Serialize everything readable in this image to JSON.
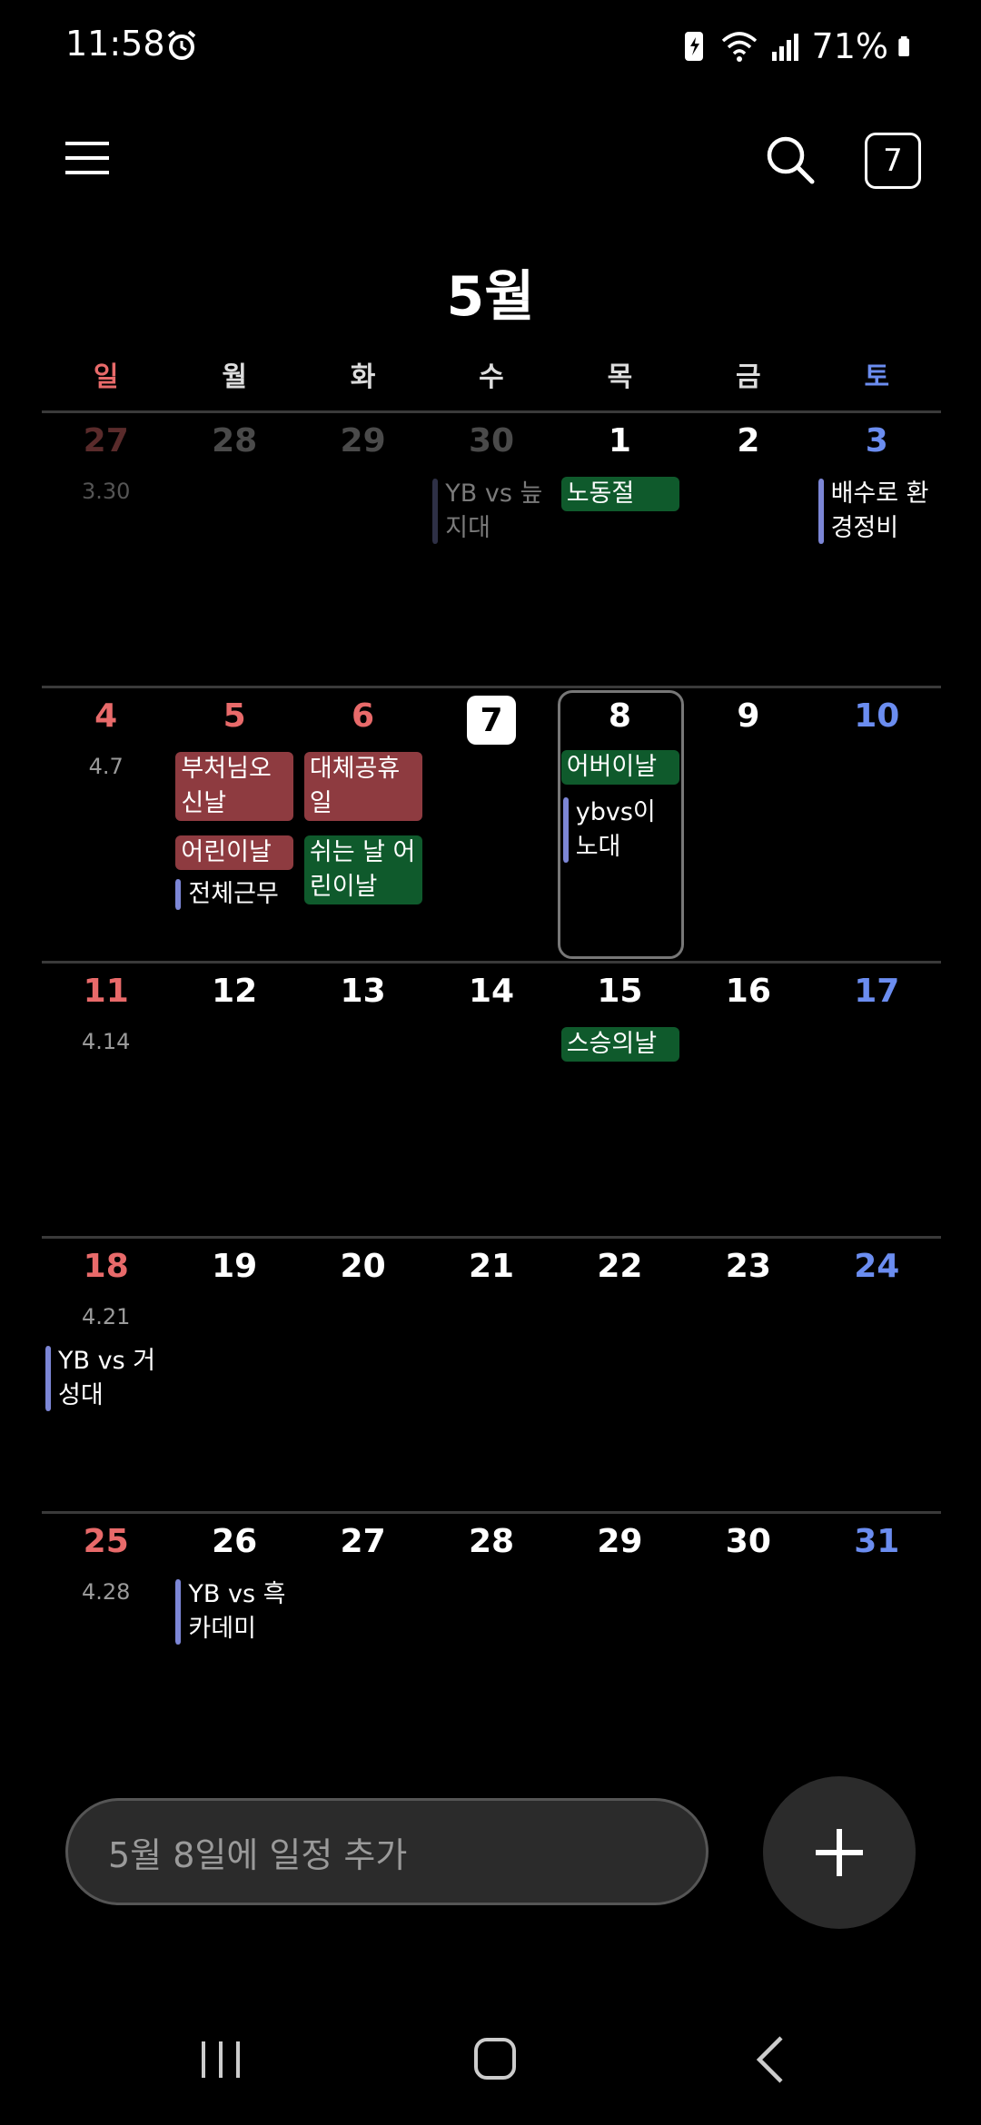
{
  "status": {
    "time": "11:58",
    "battery": "71%"
  },
  "header": {
    "today_button": "7",
    "month_title": "5월"
  },
  "weekdays": [
    "일",
    "월",
    "화",
    "수",
    "목",
    "금",
    "토"
  ],
  "weeks": [
    [
      {
        "num": "27",
        "lunar": "3.30",
        "dim": true
      },
      {
        "num": "28",
        "dim": true
      },
      {
        "num": "29",
        "dim": true
      },
      {
        "num": "30",
        "dim": true
      },
      {
        "num": "1"
      },
      {
        "num": "2"
      },
      {
        "num": "3"
      }
    ],
    [
      {
        "num": "4",
        "lunar": "4.7"
      },
      {
        "num": "5"
      },
      {
        "num": "6"
      },
      {
        "num": "7"
      },
      {
        "num": "8"
      },
      {
        "num": "9"
      },
      {
        "num": "10"
      }
    ],
    [
      {
        "num": "11",
        "lunar": "4.14"
      },
      {
        "num": "12"
      },
      {
        "num": "13"
      },
      {
        "num": "14"
      },
      {
        "num": "15"
      },
      {
        "num": "16"
      },
      {
        "num": "17"
      }
    ],
    [
      {
        "num": "18",
        "lunar": "4.21"
      },
      {
        "num": "19"
      },
      {
        "num": "20"
      },
      {
        "num": "21"
      },
      {
        "num": "22"
      },
      {
        "num": "23"
      },
      {
        "num": "24"
      }
    ],
    [
      {
        "num": "25",
        "lunar": "4.28"
      },
      {
        "num": "26"
      },
      {
        "num": "27"
      },
      {
        "num": "28"
      },
      {
        "num": "29"
      },
      {
        "num": "30"
      },
      {
        "num": "31"
      }
    ]
  ],
  "events": {
    "w0_wed": "YB vs 늪지대",
    "w0_thu": "노동절",
    "w0_sat": "배수로 환경정비",
    "w1_mon_a": "부처님오신날",
    "w1_mon_b": "어린이날",
    "w1_mon_c": "전체근무",
    "w1_tue_a": "대체공휴일",
    "w1_tue_b": "쉬는 날 어린이날",
    "w1_thu_a": "어버이날",
    "w1_thu_b": "ybvs이노대",
    "w2_thu": "스승의날",
    "w3_sun": "YB vs 거성대",
    "w4_mon": "YB vs 흑카데미"
  },
  "input": {
    "placeholder": "5월 8일에 일정 추가"
  }
}
